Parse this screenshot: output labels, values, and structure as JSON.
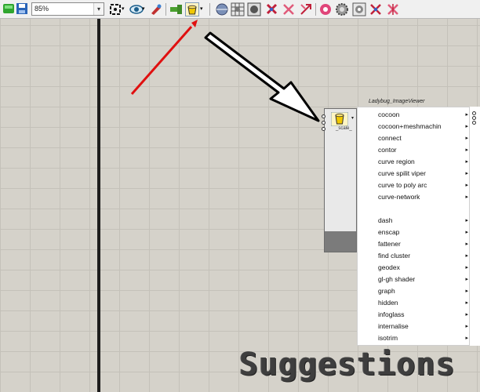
{
  "toolbar": {
    "zoom_value": "85%",
    "buttons": [
      "green-icon",
      "save-icon",
      "zoom-extents-icon",
      "preview-eye-icon",
      "preview-rocket-icon",
      "cluster-plug-icon",
      "scale-bucket-icon",
      "sphere-icon",
      "grid-icon",
      "bake-icon",
      "red-bake-icon",
      "red-cross-icon",
      "pink-circle-icon",
      "gear-icon",
      "settings-icon",
      "red-arrow-icon",
      "paint-icon"
    ]
  },
  "component": {
    "label": "_scale_",
    "viewer_title": "Ladybug_ImageViewer"
  },
  "menu": {
    "group1": [
      "cocoon",
      "cocoon+meshmachin",
      "connect",
      "contor",
      "curve region",
      "curve spilit viper",
      "curve to poly arc",
      "curve-network"
    ],
    "group2": [
      "dash",
      "enscap",
      "fattener",
      "find cluster",
      "geodex",
      "gl-gh shader",
      "graph",
      "hidden",
      "infoglass",
      "internalise",
      "isotrim"
    ],
    "submenu_arrow": "▸"
  },
  "overlay": {
    "caption": "Suggestions"
  },
  "colors": {
    "canvas": "#d5d2ca",
    "red_arrow": "#e01010",
    "black_arrow": "#000000"
  }
}
